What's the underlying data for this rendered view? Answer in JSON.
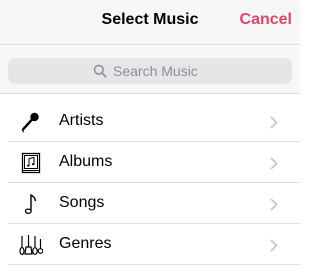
{
  "header": {
    "title": "Select Music",
    "cancel_label": "Cancel",
    "accent_color": "#e0456a"
  },
  "search": {
    "placeholder": "Search Music",
    "value": ""
  },
  "list": {
    "items": [
      {
        "label": "Artists",
        "icon": "microphone-icon"
      },
      {
        "label": "Albums",
        "icon": "album-icon"
      },
      {
        "label": "Songs",
        "icon": "music-note-icon"
      },
      {
        "label": "Genres",
        "icon": "instruments-icon"
      }
    ]
  }
}
